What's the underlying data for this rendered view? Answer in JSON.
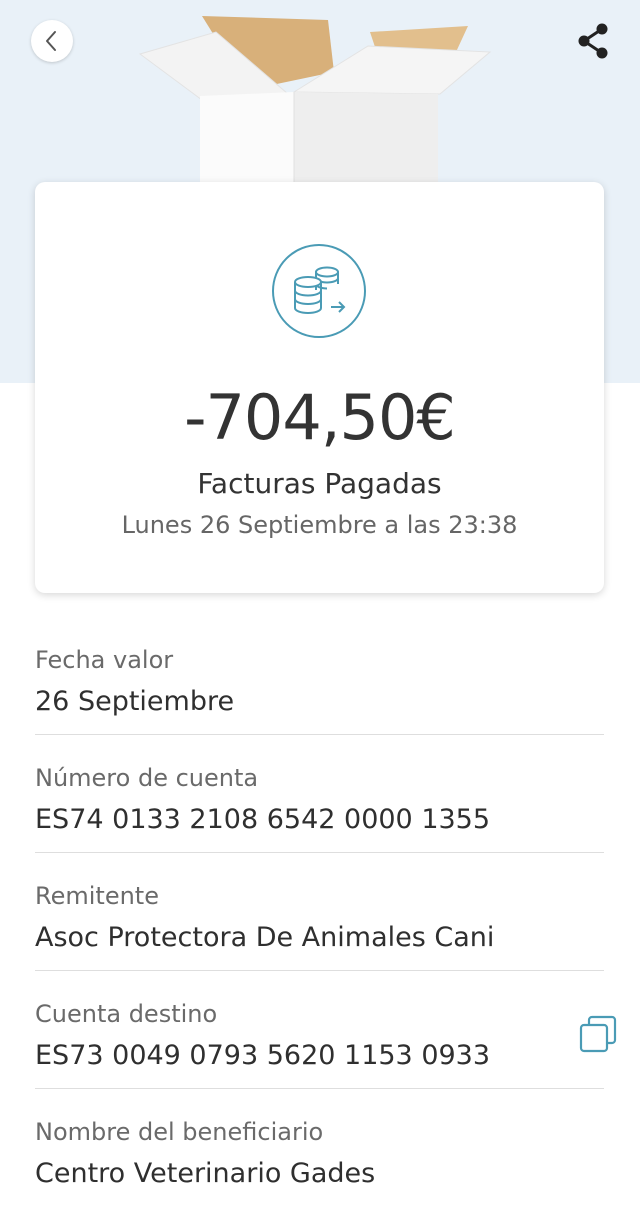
{
  "header": {
    "back_icon": "chevron-left-icon",
    "share_icon": "share-icon",
    "illustration": "open-box-illustration"
  },
  "transaction": {
    "icon": "coins-transfer-icon",
    "amount": "-704,50€",
    "category": "Facturas Pagadas",
    "datetime": "Lunes 26 Septiembre a las 23:38"
  },
  "details": [
    {
      "label": "Fecha valor",
      "value": "26 Septiembre"
    },
    {
      "label": "Número de cuenta",
      "value": "ES74 0133 2108 6542 0000 1355"
    },
    {
      "label": "Remitente",
      "value": "Asoc Protectora De Animales Cani"
    },
    {
      "label": "Cuenta destino",
      "value": "ES73 0049 0793 5620 1153 0933"
    },
    {
      "label": "Nombre del beneficiario",
      "value": "Centro Veterinario Gades"
    }
  ],
  "colors": {
    "hero_background": "#e9f1f8",
    "accent_teal": "#4a9bb5",
    "text_primary": "#333333",
    "text_secondary": "#6a6a6a"
  }
}
